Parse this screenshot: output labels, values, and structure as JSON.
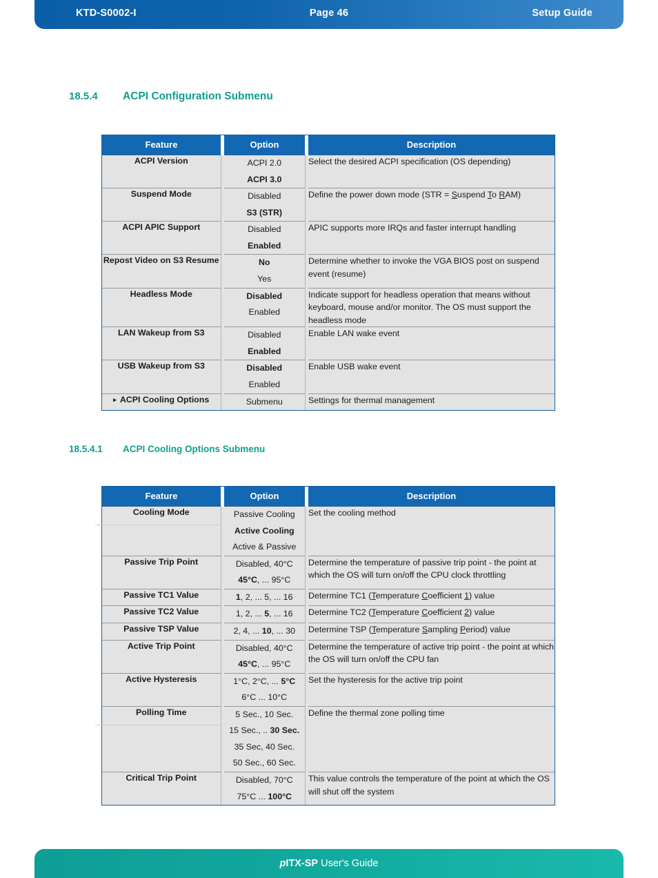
{
  "header": {
    "doc_id": "KTD-S0002-I",
    "page_label": "Page 46",
    "guide_label": "Setup Guide"
  },
  "footer": {
    "product": "pITX-SP",
    "suffix": " User's Guide"
  },
  "sections": [
    {
      "number": "18.5.4",
      "title": "ACPI Configuration Submenu"
    },
    {
      "number": "18.5.4.1",
      "title": "ACPI Cooling Options Submenu"
    }
  ],
  "colors": {
    "header_blue": "#0f63ab",
    "footer_teal": "#11a79d",
    "heading_teal": "#0f9e8e",
    "table_header_blue": "#1268b3",
    "feature_blue": "#11529c",
    "row_bg": "#e3e3e3"
  },
  "table_headers": {
    "feature": "Feature",
    "option": "Option",
    "description": "Description"
  },
  "table_acpi_configuration": [
    {
      "feature": "ACPI Version",
      "arrow": false,
      "options": [
        {
          "text": "ACPI 2.0",
          "bold": false
        },
        {
          "text": "ACPI 3.0",
          "bold": true
        }
      ],
      "description": "Select the desired ACPI specification (OS depending)"
    },
    {
      "feature": "Suspend Mode",
      "arrow": false,
      "options": [
        {
          "text": "Disabled",
          "bold": false
        },
        {
          "text": "S3 (STR)",
          "bold": true
        }
      ],
      "description": "Define the power down mode (STR = Suspend To RAM)",
      "description_html": "Define the power down mode (STR = <u>S</u>uspend <u>T</u>o <u>R</u>AM)"
    },
    {
      "feature": "ACPI APIC Support",
      "arrow": false,
      "options": [
        {
          "text": "Disabled",
          "bold": false
        },
        {
          "text": "Enabled",
          "bold": true
        }
      ],
      "description": "APIC supports more IRQs and faster interrupt handling"
    },
    {
      "feature": "Repost Video on S3 Resume",
      "arrow": false,
      "options": [
        {
          "text": "No",
          "bold": true
        },
        {
          "text": "Yes",
          "bold": false
        }
      ],
      "description": "Determine whether to invoke the VGA BIOS post on suspend event (resume)"
    },
    {
      "feature": "Headless Mode",
      "arrow": false,
      "options": [
        {
          "text": "Disabled",
          "bold": true
        },
        {
          "text": "Enabled",
          "bold": false
        }
      ],
      "description": "Indicate support for headless operation that means without keyboard, mouse and/or monitor. The OS must support the headless mode"
    },
    {
      "feature": "LAN Wakeup from S3",
      "arrow": false,
      "options": [
        {
          "text": "Disabled",
          "bold": false
        },
        {
          "text": "Enabled",
          "bold": true
        }
      ],
      "description": "Enable LAN wake event"
    },
    {
      "feature": "USB Wakeup from S3",
      "arrow": false,
      "options": [
        {
          "text": "Disabled",
          "bold": true
        },
        {
          "text": "Enabled",
          "bold": false
        }
      ],
      "description": "Enable USB wake event"
    },
    {
      "feature": "ACPI Cooling Options",
      "arrow": true,
      "options": [
        {
          "text": "Submenu",
          "bold": false
        }
      ],
      "description": "Settings for thermal management"
    }
  ],
  "table_acpi_cooling_options": [
    {
      "feature": "Cooling Mode",
      "feature_rule": true,
      "options": [
        {
          "text": "Passive Cooling",
          "bold": false
        },
        {
          "text": "Active Cooling",
          "bold": true
        },
        {
          "text": "Active & Passive",
          "bold": false
        }
      ],
      "description": "Set the cooling method"
    },
    {
      "feature": "Passive Trip Point",
      "feature_rule": false,
      "options": [
        {
          "text": "Disabled, 40°C",
          "bold": false
        },
        {
          "text": "45°C, ... 95°C",
          "bold": "partial",
          "html": "<b>45°C</b>, ... 95°C"
        }
      ],
      "description": "Determine the temperature of passive trip point - the point at which the OS will turn on/off the CPU clock throttling"
    },
    {
      "feature": "Passive TC1 Value",
      "feature_rule": false,
      "options": [
        {
          "text": "1, 2, ... 5, ... 16",
          "bold": "partial",
          "html": "<b>1</b>, 2, ... 5, ... 16"
        }
      ],
      "description": "Determine TC1 (Temperature Coefficient 1) value",
      "description_html": "Determine TC1 (<u>T</u>emperature <u>C</u>oefficient <u>1</u>) value"
    },
    {
      "feature": "Passive TC2 Value",
      "feature_rule": false,
      "options": [
        {
          "text": "1, 2, ... 5, ... 16",
          "bold": "partial",
          "html": "1, 2, ... <b>5</b>, ... 16"
        }
      ],
      "description": "Determine TC2 (Temperature Coefficient 2) value",
      "description_html": "Determine TC2 (<u>T</u>emperature <u>C</u>oefficient <u>2</u>) value"
    },
    {
      "feature": "Passive TSP Value",
      "feature_rule": false,
      "options": [
        {
          "text": "2, 4, ... 10, ... 30",
          "bold": "partial",
          "html": "2, 4, ... <b>10</b>, ... 30"
        }
      ],
      "description": "Determine TSP (Temperature Sampling Period) value",
      "description_html": "Determine TSP (<u>T</u>emperature <u>S</u>ampling <u>P</u>eriod) value"
    },
    {
      "feature": "Active Trip Point",
      "feature_rule": false,
      "options": [
        {
          "text": "Disabled, 40°C",
          "bold": false
        },
        {
          "text": "45°C, ... 95°C",
          "bold": "partial",
          "html": "<b>45°C</b>, ... 95°C"
        }
      ],
      "description": "Determine the temperature of active trip point - the point at which the OS will turn on/off the CPU fan"
    },
    {
      "feature": "Active Hysteresis",
      "feature_rule": false,
      "options": [
        {
          "text": "1°C, 2°C, ... 5°C",
          "bold": "partial",
          "html": "1°C, 2°C, ... <b>5°C</b>"
        },
        {
          "text": "6°C ... 10°C",
          "bold": false
        }
      ],
      "description": "Set the hysteresis for the active trip point"
    },
    {
      "feature": "Polling Time",
      "feature_rule": true,
      "options": [
        {
          "text": "5 Sec., 10 Sec.",
          "bold": false
        },
        {
          "text": "15 Sec., .. 30 Sec.",
          "bold": "partial",
          "html": "15 Sec., .. <b>30 Sec.</b>"
        },
        {
          "text": "35 Sec, 40 Sec.",
          "bold": false
        },
        {
          "text": "50 Sec., 60 Sec.",
          "bold": false
        }
      ],
      "description": "Define the thermal zone polling time"
    },
    {
      "feature": "Critical Trip Point",
      "feature_rule": false,
      "options": [
        {
          "text": "Disabled, 70°C",
          "bold": false
        },
        {
          "text": "75°C ... 100°C",
          "bold": "partial",
          "html": "75°C ... <b>100°C</b>"
        }
      ],
      "description": "This value controls the temperature of the point at which the OS will shut off the system"
    }
  ]
}
